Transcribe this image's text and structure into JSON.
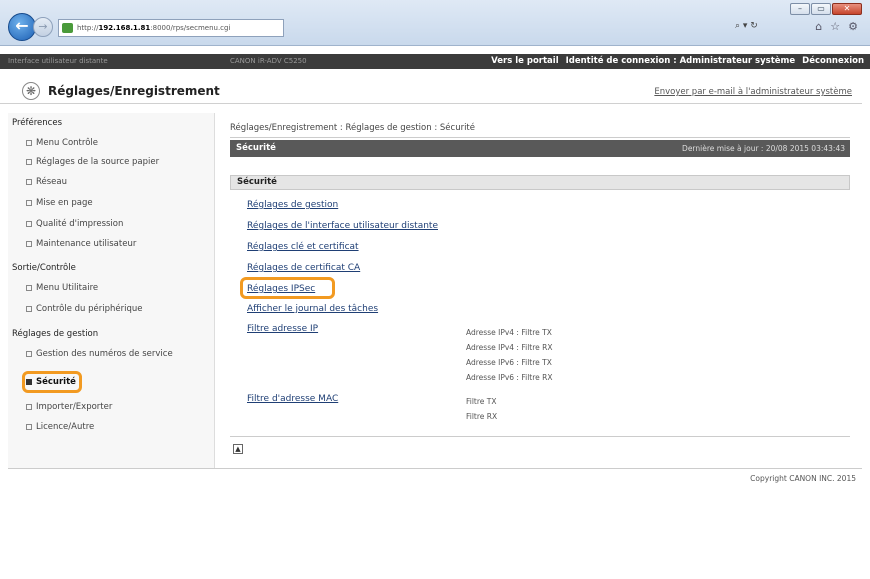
{
  "browser": {
    "address_prefix": "http://",
    "address_host": "192.168.1.81",
    "address_rest": ":8000/rps/secmenu.cgi",
    "search_tools": "⌕ ▾ ↻",
    "win_buttons": [
      "–",
      "▭",
      "✕"
    ],
    "tab_icons": [
      "⌂",
      "☆",
      "⚙"
    ]
  },
  "topbar": {
    "left": "Interface utilisateur distante",
    "mid": "CANON iR-ADV C5250",
    "portal": "Vers le portail",
    "login": "Identité de connexion : Administrateur système",
    "logout": "Déconnexion"
  },
  "header": {
    "title": "Réglages/Enregistrement",
    "email_link": "Envoyer par e-mail à l'administrateur système"
  },
  "sidebar": {
    "sections": [
      {
        "heading": "Préférences",
        "items": [
          "Menu Contrôle",
          "Réglages de la source papier",
          "Réseau",
          "Mise en page",
          "Qualité d'impression",
          "Maintenance utilisateur"
        ]
      },
      {
        "heading": "Sortie/Contrôle",
        "items": [
          "Menu Utilitaire",
          "Contrôle du périphérique"
        ]
      },
      {
        "heading": "Réglages de gestion",
        "items": [
          "Gestion des numéros de service",
          "Sécurité",
          "Importer/Exporter",
          "Licence/Autre"
        ]
      }
    ]
  },
  "main": {
    "breadcrumb": "Réglages/Enregistrement : Réglages de gestion : Sécurité",
    "bar_title": "Sécurité",
    "last_update": "Dernière mise à jour : 20/08 2015 03:43:43",
    "section_title": "Sécurité",
    "links": [
      "Réglages de gestion",
      "Réglages de l'interface utilisateur distante",
      "Réglages clé et certificat",
      "Réglages de certificat CA",
      "Réglages IPSec",
      "Afficher le journal des tâches",
      "Filtre adresse IP",
      "Filtre d'adresse MAC"
    ],
    "ip_filter_details": [
      "Adresse IPv4 : Filtre TX",
      "Adresse IPv4 : Filtre RX",
      "Adresse IPv6 : Filtre TX",
      "Adresse IPv6 : Filtre RX"
    ],
    "mac_filter_details": [
      "Filtre TX",
      "Filtre RX"
    ],
    "top_icon": "▲"
  },
  "footer": {
    "copyright": "Copyright CANON INC. 2015"
  }
}
